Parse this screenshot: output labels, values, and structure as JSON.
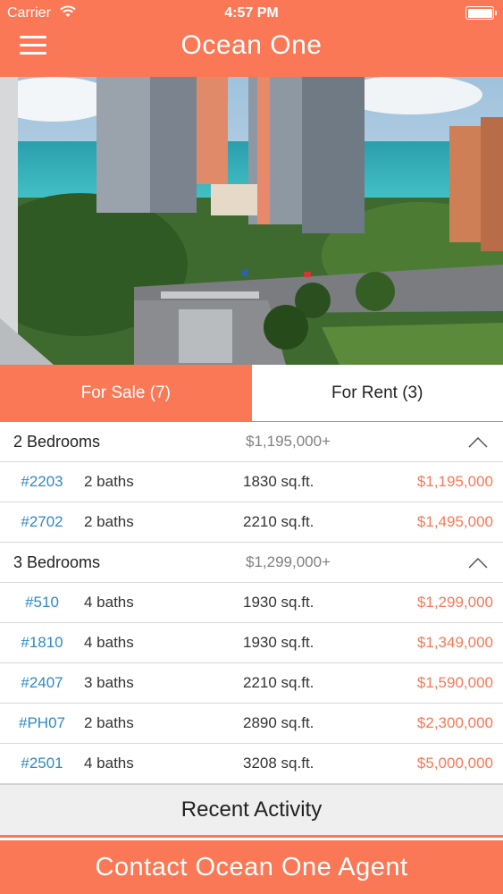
{
  "status_bar": {
    "carrier": "Carrier",
    "time": "4:57 PM"
  },
  "header": {
    "title": "Ocean One",
    "menu_icon": "hamburger-menu-icon"
  },
  "hero": {
    "description": "building-photo"
  },
  "tabs": [
    {
      "label": "For Sale (7)",
      "active": true
    },
    {
      "label": "For Rent (3)",
      "active": false
    }
  ],
  "groups": [
    {
      "title": "2 Bedrooms",
      "price": "$1,195,000+",
      "icon": "chevron-up-icon",
      "units": [
        {
          "id": "#2203",
          "baths": "2 baths",
          "sqft": "1830 sq.ft.",
          "price": "$1,195,000"
        },
        {
          "id": "#2702",
          "baths": "2 baths",
          "sqft": "2210 sq.ft.",
          "price": "$1,495,000"
        }
      ]
    },
    {
      "title": "3 Bedrooms",
      "price": "$1,299,000+",
      "icon": "chevron-up-icon",
      "units": [
        {
          "id": "#510",
          "baths": "4 baths",
          "sqft": "1930 sq.ft.",
          "price": "$1,299,000"
        },
        {
          "id": "#1810",
          "baths": "4 baths",
          "sqft": "1930 sq.ft.",
          "price": "$1,349,000"
        },
        {
          "id": "#2407",
          "baths": "3 baths",
          "sqft": "2210 sq.ft.",
          "price": "$1,590,000"
        },
        {
          "id": "#PH07",
          "baths": "2 baths",
          "sqft": "2890 sq.ft.",
          "price": "$2,300,000"
        },
        {
          "id": "#2501",
          "baths": "4 baths",
          "sqft": "3208 sq.ft.",
          "price": "$5,000,000"
        }
      ]
    }
  ],
  "recent_activity": {
    "label": "Recent Activity"
  },
  "contact": {
    "label": "Contact Ocean One Agent"
  },
  "colors": {
    "accent": "#fa7856",
    "link": "#2e8ac7",
    "muted": "#808080"
  }
}
